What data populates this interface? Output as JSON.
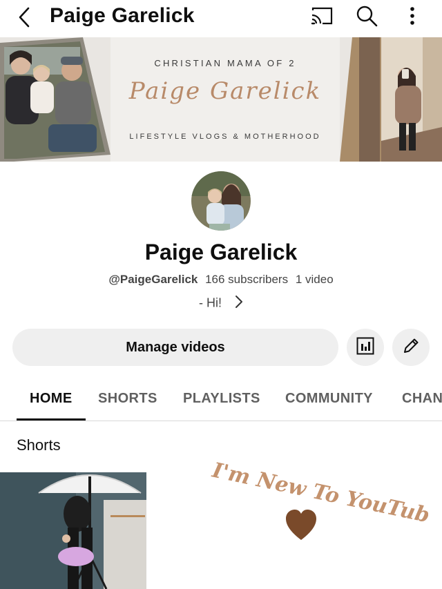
{
  "header": {
    "title": "Paige Garelick"
  },
  "banner": {
    "tagline": "CHRISTIAN MAMA OF 2",
    "script_name": "Paige Garelick",
    "subtitle": "LIFESTYLE VLOGS & MOTHERHOOD"
  },
  "channel": {
    "name": "Paige Garelick",
    "handle": "@PaigeGarelick",
    "subscribers": "166 subscribers",
    "videos": "1 video",
    "description": "- Hi!"
  },
  "actions": {
    "manage_label": "Manage videos"
  },
  "tabs": [
    {
      "label": "HOME",
      "active": true
    },
    {
      "label": "SHORTS",
      "active": false
    },
    {
      "label": "PLAYLISTS",
      "active": false
    },
    {
      "label": "COMMUNITY",
      "active": false
    },
    {
      "label": "CHANNELS",
      "active": false
    }
  ],
  "shorts": {
    "section_title": "Shorts"
  },
  "promo": {
    "text": "I'm New To YouTube"
  },
  "icons": {
    "back": "back-arrow-icon",
    "cast": "cast-icon",
    "search": "search-icon",
    "more": "more-vert-icon",
    "stats": "analytics-icon",
    "edit": "pencil-icon",
    "chevron": "chevron-right-icon",
    "heart": "heart-icon"
  },
  "colors": {
    "accent_script": "#b88a69",
    "heart": "#7a4a2a",
    "promo_text": "#c4926d"
  }
}
